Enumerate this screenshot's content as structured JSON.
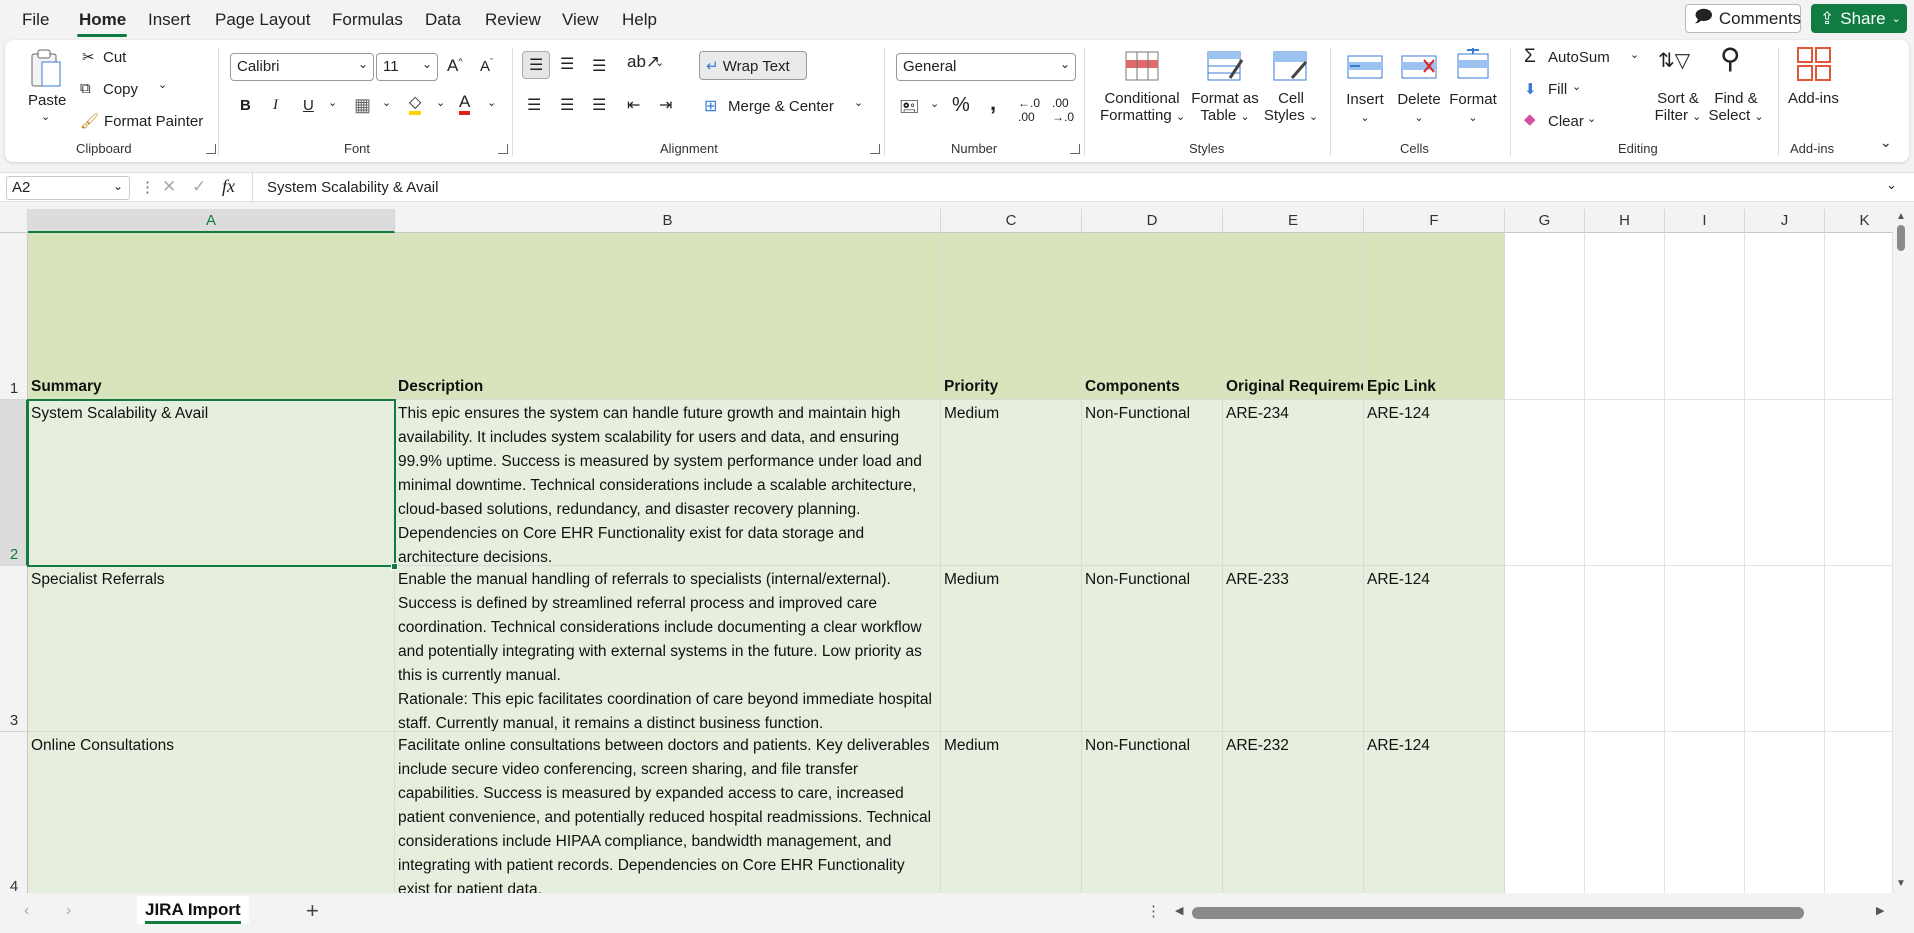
{
  "menu": {
    "items": [
      "File",
      "Home",
      "Insert",
      "Page Layout",
      "Formulas",
      "Data",
      "Review",
      "View",
      "Help"
    ],
    "active": "Home"
  },
  "top_buttons": {
    "comments": "Comments",
    "share": "Share"
  },
  "ribbon": {
    "clipboard": {
      "paste": "Paste",
      "cut": "Cut",
      "copy": "Copy",
      "format_painter": "Format Painter",
      "label": "Clipboard"
    },
    "font": {
      "name": "Calibri",
      "size": "11",
      "bold": "B",
      "italic": "I",
      "underline": "U",
      "label": "Font"
    },
    "alignment": {
      "wrap_text": "Wrap Text",
      "merge_center": "Merge & Center",
      "label": "Alignment"
    },
    "number": {
      "format": "General",
      "percent": "%",
      "comma": ",",
      "label": "Number"
    },
    "styles": {
      "conditional": "Conditional",
      "formatting": "Formatting",
      "format_as": "Format as",
      "table": "Table",
      "cell": "Cell",
      "cell_styles": "Styles",
      "label": "Styles"
    },
    "cells": {
      "insert": "Insert",
      "delete": "Delete",
      "format": "Format",
      "label": "Cells"
    },
    "editing": {
      "autosum": "AutoSum",
      "fill": "Fill",
      "clear": "Clear",
      "sort": "Sort &",
      "filter": "Filter",
      "find": "Find &",
      "select": "Select",
      "label": "Editing"
    },
    "addins": {
      "addins": "Add-ins",
      "label": "Add-ins"
    }
  },
  "formula_bar": {
    "name_box": "A2",
    "fx": "fx",
    "content": "System Scalability & Avail"
  },
  "columns": [
    "A",
    "B",
    "C",
    "D",
    "E",
    "F",
    "G",
    "H",
    "I",
    "J",
    "K"
  ],
  "rows": [
    "1",
    "2",
    "3",
    "4"
  ],
  "header_row": {
    "a": "Summary",
    "b": "Description",
    "c": "Priority",
    "d": "Components",
    "e": "Original Requirement",
    "f": "Epic Link"
  },
  "data_rows": [
    {
      "a": "System Scalability & Avail",
      "b": "This epic ensures the system can handle future growth and maintain high availability. It includes system scalability for users and data, and ensuring 99.9% uptime.  Success is measured by system performance under load and minimal downtime.  Technical considerations include a scalable architecture, cloud-based solutions, redundancy, and disaster recovery planning. Dependencies on Core EHR Functionality exist for data storage and architecture decisions.",
      "c": "Medium",
      "d": "Non-Functional",
      "e": "ARE-234",
      "f": "ARE-124"
    },
    {
      "a": "Specialist Referrals",
      "b": "Enable the manual handling of referrals to specialists (internal/external). Success is defined by streamlined referral process and improved care coordination. Technical considerations include documenting a clear workflow and potentially integrating with external systems in the future. Low priority as this is currently manual.\nRationale: This epic facilitates coordination of care beyond immediate hospital staff.  Currently manual, it remains a distinct business function.",
      "c": "Medium",
      "d": "Non-Functional",
      "e": "ARE-233",
      "f": "ARE-124"
    },
    {
      "a": "Online Consultations",
      "b": "Facilitate online consultations between doctors and patients. Key deliverables include secure video conferencing, screen sharing, and file transfer capabilities. Success is measured by expanded access to care, increased patient convenience, and potentially reduced hospital readmissions. Technical considerations include HIPAA compliance, bandwidth management, and integrating with patient records. Dependencies on Core EHR Functionality exist for patient data.",
      "c": "Medium",
      "d": "Non-Functional",
      "e": "ARE-232",
      "f": "ARE-124"
    }
  ],
  "sheet_tabs": [
    "JIRA Import"
  ],
  "colors": {
    "accent": "#107c41",
    "header_fill": "#d8e4bc",
    "data_fill": "#e6efdd"
  }
}
